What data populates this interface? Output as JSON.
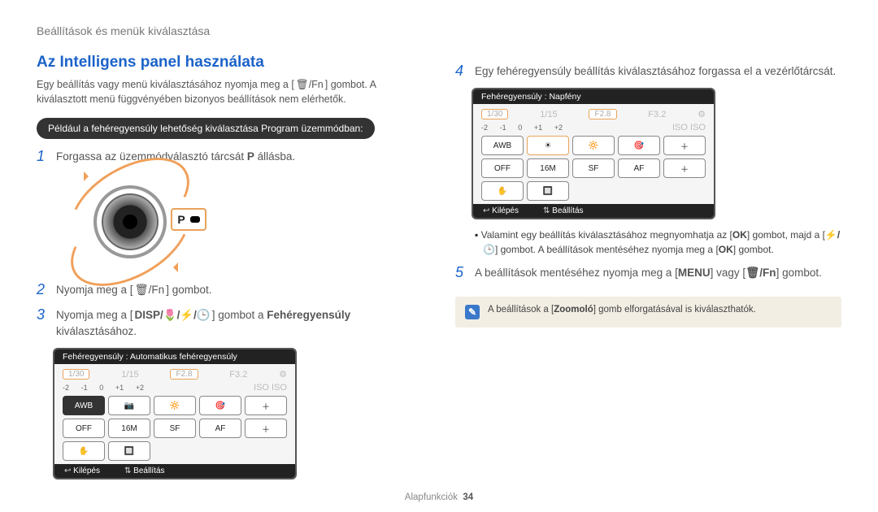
{
  "chapter": "Beállítások és menük kiválasztása",
  "title": "Az Intelligens panel használata",
  "intro_parts": {
    "a": "Egy beállítás vagy menü kiválasztásához nyomja meg a [",
    "key": "🗑/Fn",
    "b": "] gombot. A kiválasztott menü függvényében bizonyos beállítások nem elérhetők."
  },
  "example_pill": "Például a fehéregyensúly lehetőség kiválasztása Program üzemmódban:",
  "steps_left": [
    {
      "n": "1",
      "a": "Forgassa az üzemmódválasztó tárcsát ",
      "b_bold": "P",
      "c": " állásba."
    },
    {
      "n": "2",
      "a": "Nyomja meg a [",
      "key": "🗑/Fn",
      "c": "] gombot."
    },
    {
      "n": "3",
      "a": "Nyomja meg a [",
      "key": "DISP/🌷/⚡/🕒",
      "mid": "] gombot a ",
      "b_bold": "Fehéregyensúly",
      "c": " kiválasztásához."
    }
  ],
  "steps_right": [
    {
      "n": "4",
      "a": "Egy fehéregyensúly beállítás kiválasztásához forgassa el a vezérlőtárcsát."
    },
    {
      "n": "5",
      "a": "A beállítások mentéséhez nyomja meg a [",
      "key1": "MENU",
      "mid": "] vagy [",
      "key2": "🗑/Fn",
      "c": "] gombot."
    }
  ],
  "bullet": {
    "a": "Valamint egy beállítás kiválasztásához megnyomhatja az [",
    "key1": "OK",
    "b": "] gombot, majd a [",
    "key2": "⚡/🕒",
    "c": "] gombot. A beállítások mentéséhez nyomja meg a [",
    "key3": "OK",
    "d": "] gombot."
  },
  "info_box": {
    "a": "A beállítások a [",
    "bold": "Zoomoló",
    "b": "] gomb elforgatásával is kiválaszthatók."
  },
  "dial_letter": "P",
  "lcd_left": {
    "title": "Fehéregyensúly : Automatikus fehéregyensúly",
    "shutter": "1/30",
    "aperture": "F2.8",
    "ev": [
      "-2",
      "-1",
      "0",
      "+1",
      "+2"
    ],
    "chips_row1": [
      "AWB",
      "📷",
      "🔆",
      "🎯",
      "＋"
    ],
    "chips_row2": [
      "OFF",
      "16M",
      "SF",
      "AF",
      "＋"
    ],
    "chips_row3": [
      "✋",
      "🔲",
      "",
      "",
      ""
    ],
    "footer_exit": "Kilépés",
    "footer_set": "Beállítás"
  },
  "lcd_right": {
    "title": "Fehéregyensúly : Napfény",
    "shutter": "1/30",
    "aperture": "F2.8",
    "ev": [
      "-2",
      "-1",
      "0",
      "+1",
      "+2"
    ],
    "chips_row1": [
      "AWB",
      "☀",
      "🔆",
      "🎯",
      "＋"
    ],
    "chips_row2": [
      "OFF",
      "16M",
      "SF",
      "AF",
      "＋"
    ],
    "chips_row3": [
      "✋",
      "🔲",
      "",
      "",
      ""
    ],
    "footer_exit": "Kilépés",
    "footer_set": "Beállítás"
  },
  "footer": {
    "label": "Alapfunkciók",
    "page": "34"
  }
}
